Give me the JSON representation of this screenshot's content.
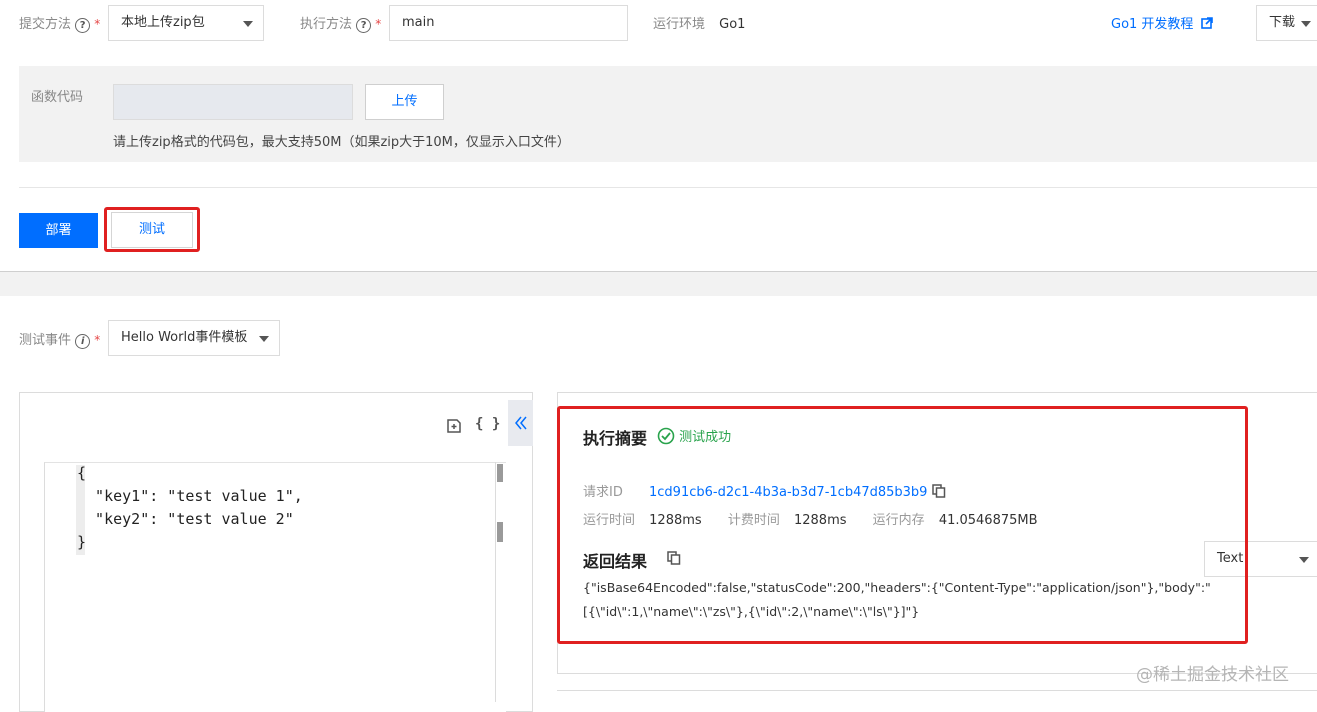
{
  "form": {
    "submit_method_label": "提交方法",
    "submit_method_value": "本地上传zip包",
    "exec_method_label": "执行方法",
    "exec_method_value": "main",
    "runtime_label": "运行环境",
    "runtime_value": "Go1",
    "tutorial_link": "Go1 开发教程",
    "download_label": "下载"
  },
  "code_section": {
    "label": "函数代码",
    "upload_button": "上传",
    "hint": "请上传zip格式的代码包，最大支持50M（如果zip大于10M，仅显示入口文件）"
  },
  "actions": {
    "deploy": "部署",
    "test": "测试"
  },
  "test_event": {
    "label": "测试事件",
    "template": "Hello World事件模板"
  },
  "editor": {
    "toolbar_format": "{ }",
    "lines": [
      "{",
      "  \"key1\": \"test value 1\",",
      "  \"key2\": \"test value 2\"",
      "}"
    ]
  },
  "result": {
    "summary_title": "执行摘要",
    "status": "测试成功",
    "request_id_label": "请求ID",
    "request_id": "1cd91cb6-d2c1-4b3a-b3d7-1cb47d85b3b9",
    "run_time_label": "运行时间",
    "run_time": "1288ms",
    "bill_time_label": "计费时间",
    "bill_time": "1288ms",
    "memory_label": "运行内存",
    "memory": "41.0546875MB",
    "return_title": "返回结果",
    "format_select": "Text",
    "body_line1": "{\"isBase64Encoded\":false,\"statusCode\":200,\"headers\":{\"Content-Type\":\"application/json\"},\"body\":\"",
    "body_line2": "[{\\\"id\\\":1,\\\"name\\\":\\\"zs\\\"},{\\\"id\\\":2,\\\"name\\\":\\\"ls\\\"}]\"}"
  },
  "watermark": "@稀土掘金技术社区"
}
